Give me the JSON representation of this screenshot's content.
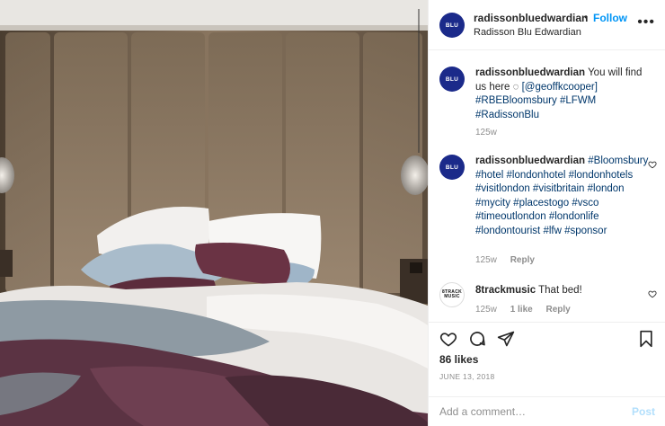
{
  "post": {
    "username": "radissonbluedwardian",
    "avatar_text": "BLU",
    "follow_label": "Follow",
    "separator": "•",
    "location": "Radisson Blu Edwardian",
    "more_icon": "more-horizontal-icon"
  },
  "comments": [
    {
      "username": "radissonbluedwardian",
      "avatar_text": "BLU",
      "text": "You will find us here ",
      "mention": "[@geoffkcooper]",
      "tags": "#RBEBloomsbury #LFWM #RadissonBlu",
      "age": "125w"
    },
    {
      "username": "radissonbluedwardian",
      "avatar_text": "BLU",
      "tags": "#Bloomsbury #hotel #londonhotel #londonhotels #visitlondon #visitbritain #london #mycity #placestogo #vsco #timeoutlondon #londonlife #londontourist #lfw #sponsor",
      "age": "125w",
      "reply_label": "Reply"
    },
    {
      "username": "8trackmusic",
      "avatar_text_1": "8TRACK",
      "avatar_text_2": "MUSIC",
      "text": "That bed!",
      "age": "125w",
      "likes": "1 like",
      "reply_label": "Reply"
    }
  ],
  "actions": {
    "icons": [
      "heart-icon",
      "comment-icon",
      "share-icon",
      "bookmark-icon"
    ],
    "likes": "86 likes",
    "date": "JUNE 13, 2018"
  },
  "add_comment": {
    "placeholder": "Add a comment…",
    "post_label": "Post"
  },
  "colors": {
    "link_blue": "#0095f6",
    "hashtag": "#00376b",
    "brand": "#1b2a8a",
    "muted": "#8e8e8e"
  }
}
